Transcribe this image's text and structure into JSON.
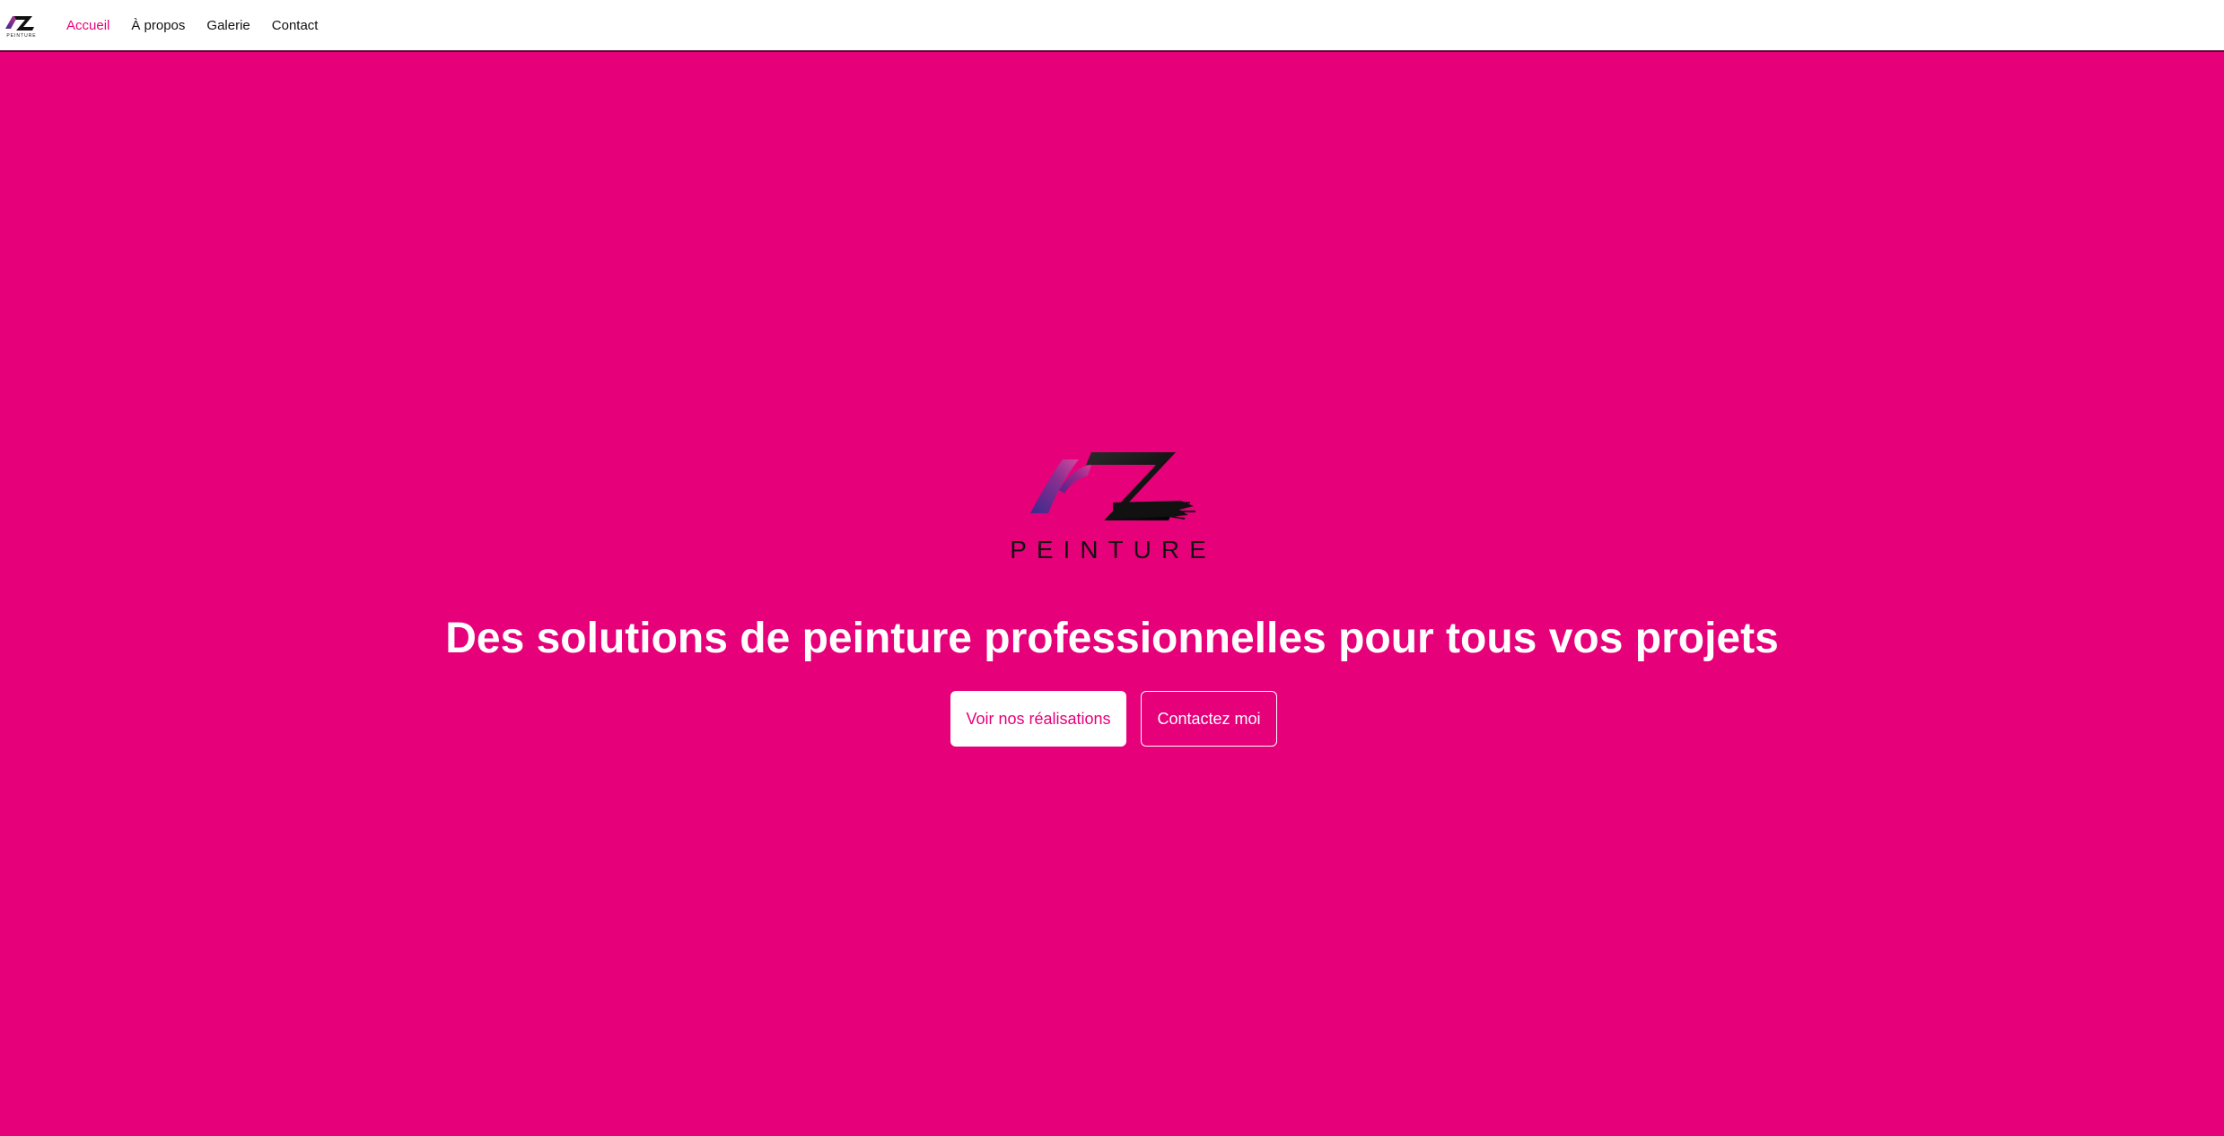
{
  "brand": {
    "logo_text": "PEINTURE"
  },
  "nav": {
    "items": [
      {
        "label": "Accueil",
        "active": true
      },
      {
        "label": "À propos",
        "active": false
      },
      {
        "label": "Galerie",
        "active": false
      },
      {
        "label": "Contact",
        "active": false
      }
    ]
  },
  "hero": {
    "title": "Des solutions de peinture professionnelles pour tous vos projets",
    "primary_button": "Voir nos réalisations",
    "secondary_button": "Contactez moi"
  },
  "colors": {
    "accent": "#e6007a",
    "nav_background": "#ffffff",
    "logo_dark": "#111111",
    "logo_purple": "#5b2a86"
  }
}
